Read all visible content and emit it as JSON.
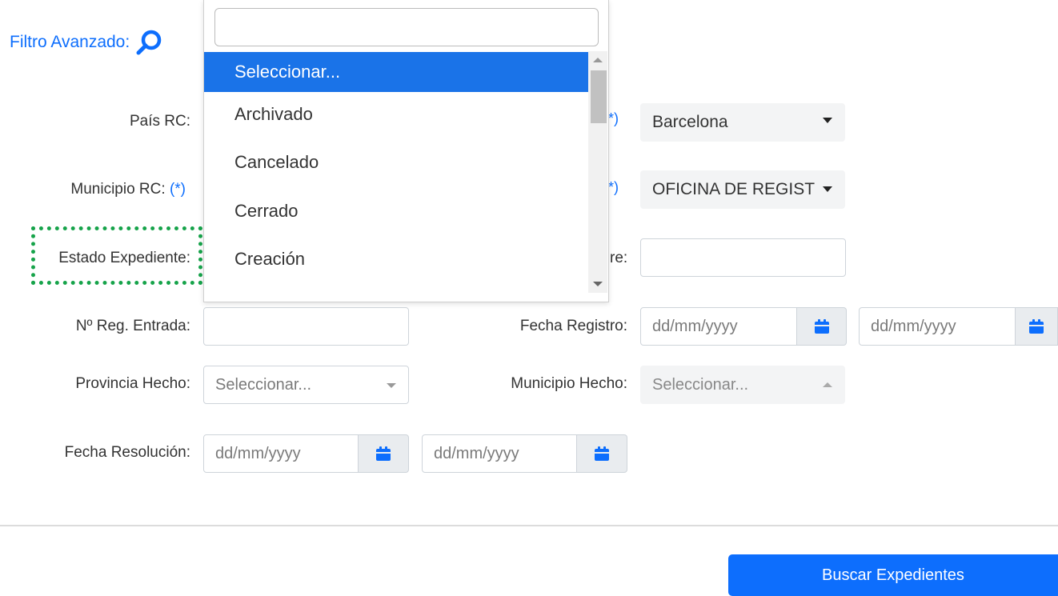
{
  "title": "Filtro Avanzado:",
  "required_marker": "(*)",
  "labels": {
    "pais_rc": "País RC:",
    "municipio_rc": "Municipio RC:",
    "estado_expediente": "Estado Expediente:",
    "reg_entrada": "Nº Reg. Entrada:",
    "fecha_registro": "Fecha Registro:",
    "provincia_hecho": "Provincia Hecho:",
    "municipio_hecho": "Municipio Hecho:",
    "fecha_resolucion": "Fecha Resolución:",
    "partial_label_fragment": "re:"
  },
  "values": {
    "provincia_rc": "Barcelona",
    "oficina": "OFICINA DE REGIST"
  },
  "placeholders": {
    "date": "dd/mm/yyyy",
    "select": "Seleccionar..."
  },
  "dropdown": {
    "search_value": "",
    "options": [
      "Seleccionar...",
      "Archivado",
      "Cancelado",
      "Cerrado",
      "Creación"
    ],
    "selected_index": 0
  },
  "buttons": {
    "search": "Buscar Expedientes"
  },
  "colors": {
    "accent": "#0d6efd",
    "highlight": "#16a34a",
    "dropdown_selected": "#1a73e8"
  }
}
